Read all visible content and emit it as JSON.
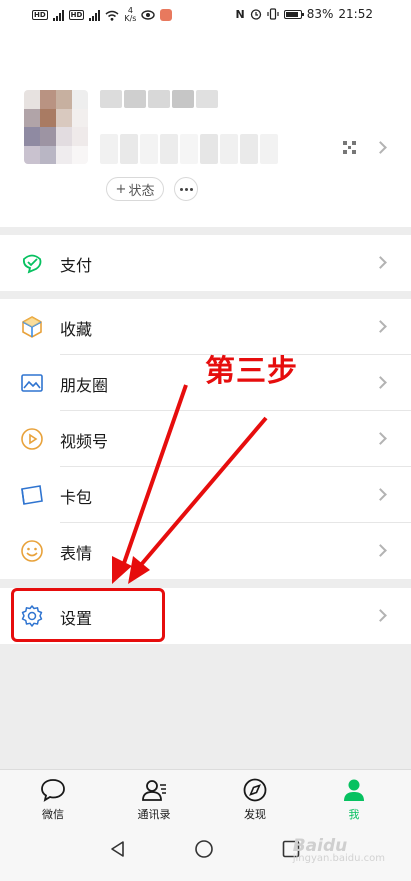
{
  "status_bar": {
    "left_chips": [
      "HD",
      "HD"
    ],
    "net_speed_value": "4",
    "net_speed_unit": "K/s",
    "battery": "83%",
    "time": "21:52"
  },
  "profile": {
    "status_label": "状态",
    "status_plus": "+"
  },
  "menu": {
    "pay": "支付",
    "favorites": "收藏",
    "moments": "朋友圈",
    "channels": "视频号",
    "cards": "卡包",
    "stickers": "表情",
    "settings": "设置"
  },
  "annotation": {
    "step_text": "第三步",
    "color": "#e60d0d"
  },
  "tabbar": {
    "items": [
      {
        "label": "微信",
        "icon": "chat-bubble-icon"
      },
      {
        "label": "通讯录",
        "icon": "contacts-icon"
      },
      {
        "label": "发现",
        "icon": "compass-icon"
      },
      {
        "label": "我",
        "icon": "person-icon"
      }
    ],
    "active_color": "#07c160"
  },
  "watermark": {
    "brand": "Baidu",
    "sub": "jingyan.baidu.com"
  }
}
